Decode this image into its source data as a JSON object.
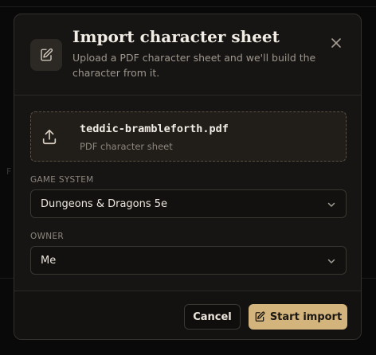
{
  "dialog": {
    "title": "Import character sheet",
    "subtitle": "Upload a PDF character sheet and we'll build the character from it."
  },
  "file": {
    "name": "teddic-brambleforth.pdf",
    "description": "PDF character sheet"
  },
  "game_system": {
    "label": "GAME SYSTEM",
    "value": "Dungeons & Dragons 5e"
  },
  "owner": {
    "label": "OWNER",
    "value": "Me"
  },
  "footer": {
    "cancel_label": "Cancel",
    "start_label": "Start import"
  },
  "colors": {
    "accent": "#d2b47c",
    "modal_bg": "#161514",
    "backdrop": "#0a0909"
  },
  "icons": {
    "header": "edit-document-icon",
    "close": "close-icon",
    "file": "upload-icon",
    "select": "chevron-down-icon",
    "start": "edit-document-icon"
  }
}
